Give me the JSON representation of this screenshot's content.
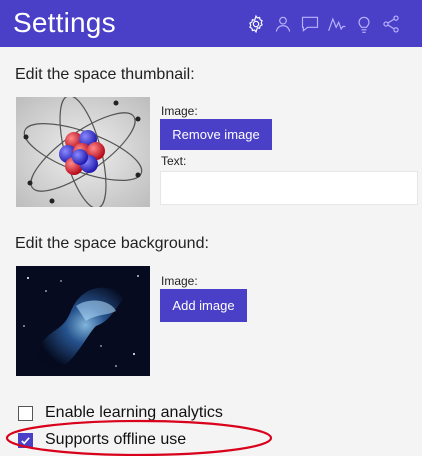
{
  "header": {
    "title": "Settings",
    "icons": [
      "settings-gear-icon",
      "user-icon",
      "comment-icon",
      "analytics-icon",
      "lightbulb-icon",
      "share-icon"
    ]
  },
  "thumbnail": {
    "heading": "Edit the space thumbnail:",
    "image_label": "Image:",
    "remove_button": "Remove image",
    "text_label": "Text:",
    "text_value": ""
  },
  "background": {
    "heading": "Edit the space background:",
    "image_label": "Image:",
    "add_button": "Add image"
  },
  "options": {
    "analytics_label": "Enable learning analytics",
    "analytics_checked": false,
    "offline_label": "Supports offline use",
    "offline_checked": true
  },
  "colors": {
    "accent": "#4a3fc7",
    "header_bg": "#4a3fc7",
    "annotation": "#d9001b"
  }
}
